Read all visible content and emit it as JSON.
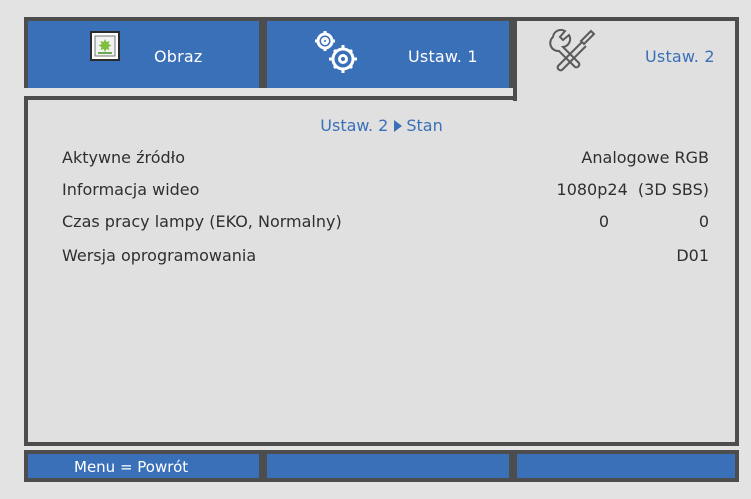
{
  "tabs": [
    {
      "label": "Obraz",
      "icon": "picture-icon",
      "active": false
    },
    {
      "label": "Ustaw. 1",
      "icon": "gears-icon",
      "active": false
    },
    {
      "label": "Ustaw. 2",
      "icon": "tools-icon",
      "active": true
    }
  ],
  "breadcrumb": {
    "parent": "Ustaw. 2",
    "current": "Stan"
  },
  "rows": [
    {
      "label": "Aktywne źródło",
      "value": "Analogowe RGB"
    },
    {
      "label": "Informacja wideo",
      "value": "1080p24  (3D SBS)"
    },
    {
      "label": "Czas pracy lampy (EKO, Normalny)",
      "value_eco": "0",
      "value_normal": "0"
    },
    {
      "label": "Wersja oprogramowania",
      "value": "D01"
    }
  ],
  "footer": {
    "hint": "Menu = Powrót"
  },
  "colors": {
    "accent": "#3a70b8",
    "border": "#4d4d4d",
    "panel": "#e0e0e0"
  }
}
